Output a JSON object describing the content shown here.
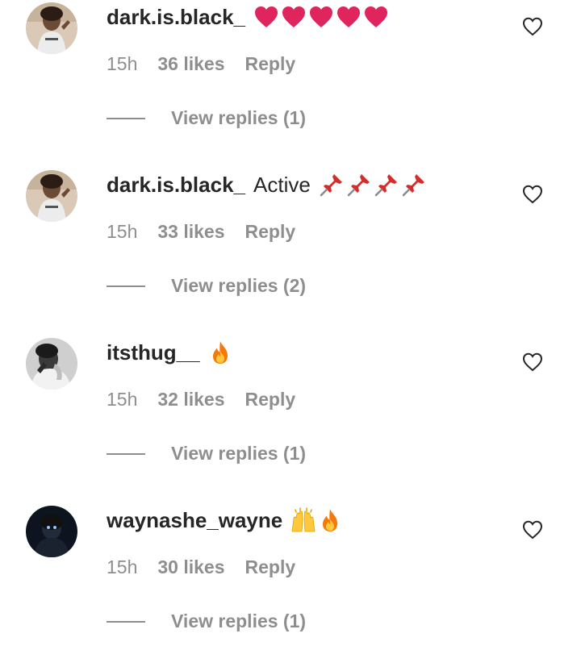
{
  "comments": [
    {
      "username": "dark.is.black_",
      "text": "",
      "emoji": "heart-red",
      "emoji_count": 5,
      "time": "15h",
      "likes": "36 likes",
      "reply": "Reply",
      "view_replies": "View replies (1)"
    },
    {
      "username": "dark.is.black_",
      "text": "Active",
      "emoji": "pushpin",
      "emoji_count": 4,
      "time": "15h",
      "likes": "33 likes",
      "reply": "Reply",
      "view_replies": "View replies (2)"
    },
    {
      "username": "itsthug__",
      "text": "",
      "emoji": "fire",
      "emoji_count": 1,
      "time": "15h",
      "likes": "32 likes",
      "reply": "Reply",
      "view_replies": "View replies (1)"
    },
    {
      "username": "waynashe_wayne",
      "text": "",
      "emoji": "raised-hands-fire",
      "emoji_count": 2,
      "time": "15h",
      "likes": "30 likes",
      "reply": "Reply",
      "view_replies": "View replies (1)"
    }
  ],
  "colors": {
    "text": "#262626",
    "muted": "#8e8e8e",
    "heart_red": "#e0245e"
  },
  "icons": {
    "like": "heart-outline-icon"
  }
}
